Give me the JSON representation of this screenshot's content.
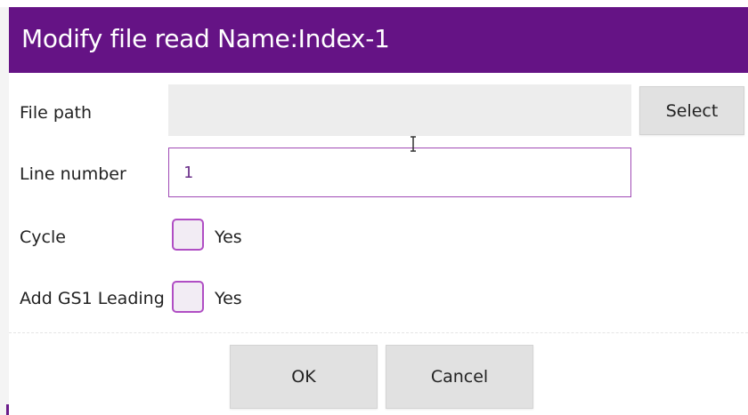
{
  "dialog": {
    "title": "Modify file read Name:Index-1",
    "accent_color": "#651385",
    "fields": {
      "file_path": {
        "label": "File path",
        "value": "",
        "select_label": "Select"
      },
      "line_number": {
        "label": "Line number",
        "value": "1"
      },
      "cycle": {
        "label": "Cycle",
        "checked": false,
        "option_label": "Yes"
      },
      "add_gs1_leading": {
        "label": "Add GS1 Leading",
        "checked": false,
        "option_label": "Yes"
      }
    },
    "buttons": {
      "ok_label": "OK",
      "cancel_label": "Cancel"
    },
    "cursor_icon": "text-cursor-icon"
  }
}
